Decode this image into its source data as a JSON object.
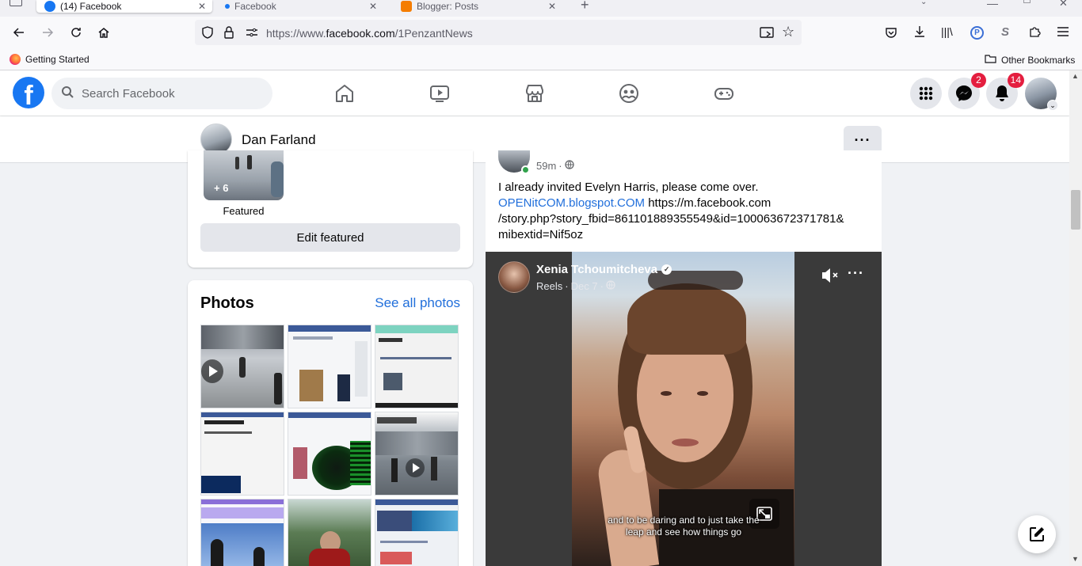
{
  "browser": {
    "tabs": [
      {
        "label": "(14) Facebook",
        "active": true
      },
      {
        "label": "Facebook",
        "active": false
      },
      {
        "label": "Blogger: Posts",
        "active": false
      }
    ],
    "url_prefix": "https://www.",
    "url_domain": "facebook.com",
    "url_path": "/1PenzantNews",
    "bookmarks": {
      "getting_started": "Getting Started",
      "other": "Other Bookmarks"
    }
  },
  "fb_header": {
    "search_placeholder": "Search Facebook",
    "messenger_badge": "2",
    "notifications_badge": "14",
    "brand_color": "#1877f2"
  },
  "profile_bar": {
    "name": "Dan Farland"
  },
  "featured": {
    "more_count": "+ 6",
    "label": "Featured",
    "edit_button": "Edit featured"
  },
  "photos": {
    "title": "Photos",
    "see_all": "See all photos"
  },
  "post": {
    "time": "59m",
    "text_line1": "I already invited Evelyn Harris, please come over.",
    "link_text": "OPENitCOM.blogspot.COM",
    "url_text": "https://m.facebook.com",
    "url_cont1": "/story.php?story_fbid=861101889355549&id=100063672371781&",
    "url_cont2": "mibextid=Nif5oz",
    "video": {
      "author": "Xenia Tchoumitcheva",
      "source": "Reels",
      "date": "Dec 7",
      "caption": "and to be daring and to just take the leap and see how things go"
    }
  }
}
